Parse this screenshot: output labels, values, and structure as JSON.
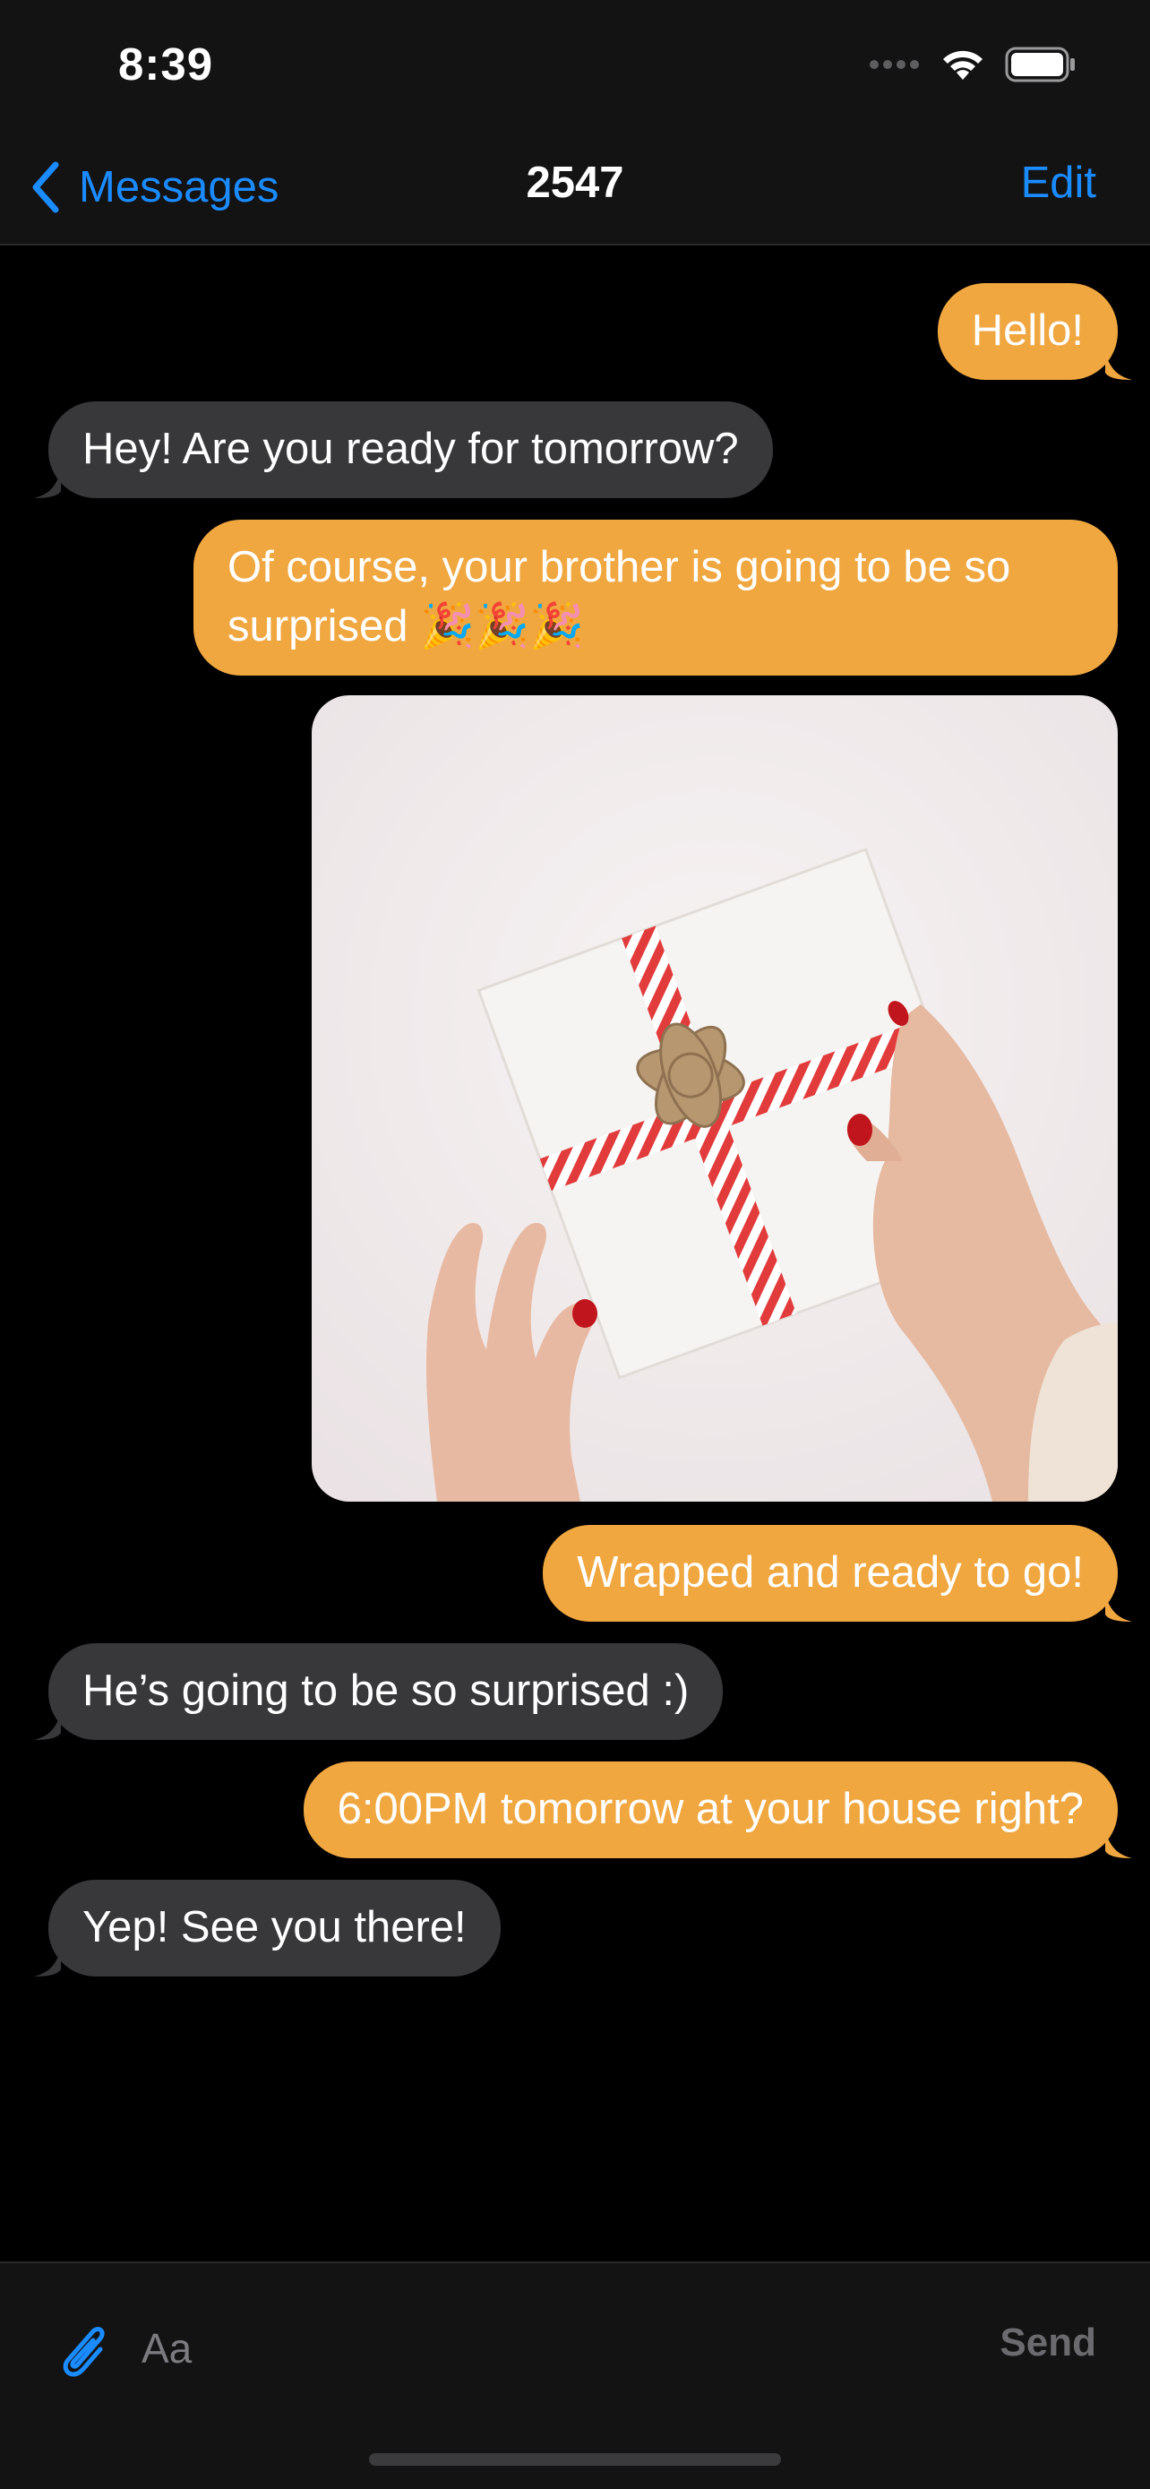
{
  "status_bar": {
    "time": "8:39",
    "icons": [
      "cellular-signal-icon",
      "wifi-icon",
      "battery-icon"
    ]
  },
  "nav": {
    "back_label": "Messages",
    "title": "2547",
    "edit_label": "Edit",
    "accent_color": "#1a8cff"
  },
  "messages": [
    {
      "direction": "outgoing",
      "text": "Hello!"
    },
    {
      "direction": "incoming",
      "text": "Hey! Are you ready for tomorrow?"
    },
    {
      "direction": "outgoing",
      "text": "Of course, your brother is going to be so surprised 🎉🎉🎉"
    },
    {
      "direction": "outgoing",
      "type": "photo",
      "alt": "gift-photo"
    },
    {
      "direction": "outgoing",
      "text": "Wrapped and ready to go!"
    },
    {
      "direction": "incoming",
      "text": "He’s going to be so surprised :)"
    },
    {
      "direction": "outgoing",
      "text": "6:00PM tomorrow at your house right?"
    },
    {
      "direction": "incoming",
      "text": "Yep! See you there!"
    }
  ],
  "colors": {
    "outgoing_bubble": "#f0a740",
    "incoming_bubble": "#38383a",
    "background": "#000000",
    "bar_background": "#131313"
  },
  "composer": {
    "placeholder": "Aa",
    "send_label": "Send",
    "attach_icon": "paperclip-icon"
  }
}
